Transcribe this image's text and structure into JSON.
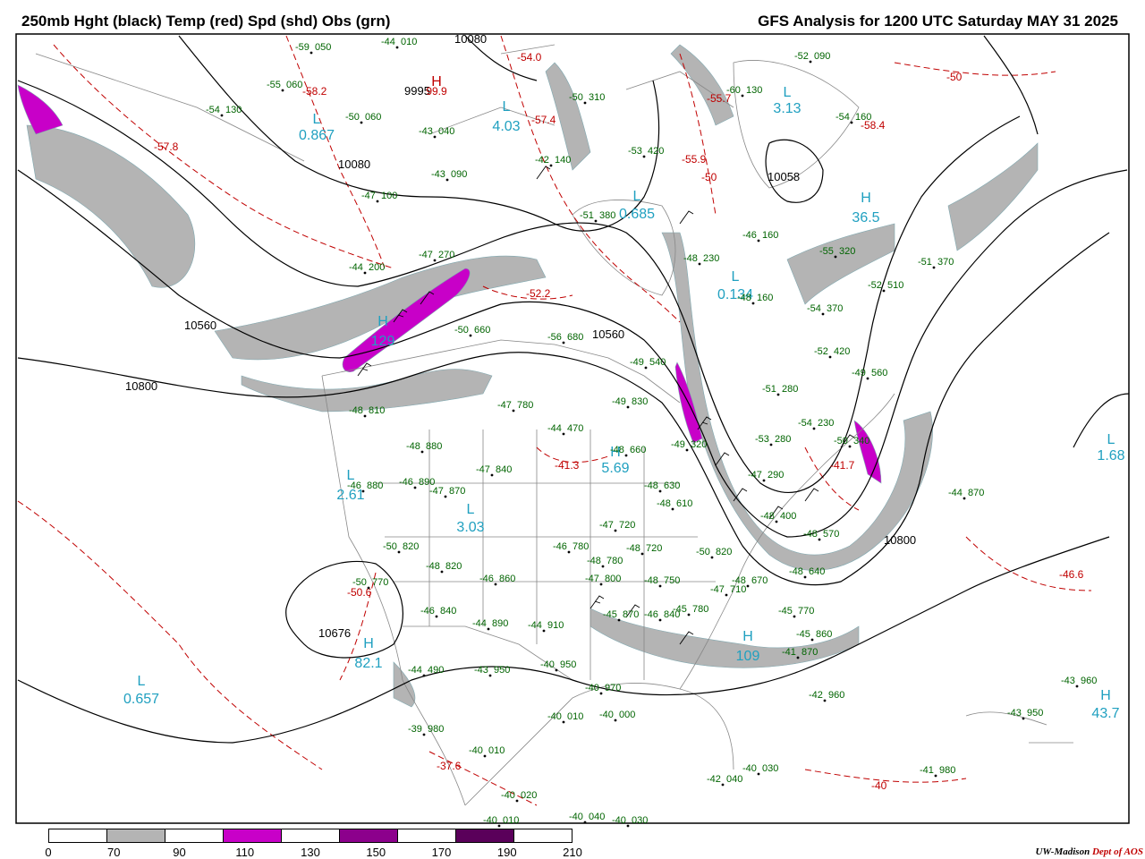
{
  "header": {
    "left_title": "250mb Hght (black) Temp (red) Spd (shd) Obs (grn)",
    "right_title": "GFS Analysis for 1200 UTC Saturday  MAY 31 2025"
  },
  "colors": {
    "height": "#000000",
    "temp": "#c00000",
    "obs": "#006400",
    "label_cyan": "#20a0c0",
    "shade_70": "#b4b4b4",
    "shade_110": "#c800c8",
    "shade_150": "#8c008c",
    "shade_190": "#5a005a",
    "borders": "#888888"
  },
  "height_labels": [
    "10800",
    "10560",
    "10080",
    "10800",
    "10560",
    "10800",
    "10058",
    "10676",
    "10080",
    "9995"
  ],
  "temp_labels": [
    "-54.0",
    "-58.2",
    "-57.8",
    "-57.4",
    "-55.9",
    "-55.7",
    "-50",
    "-58.4",
    "-52.2",
    "-41.3",
    "-41.7",
    "-46.6",
    "-37.6",
    "-40",
    "-50",
    "-50.6"
  ],
  "centers": [
    {
      "letter": "H",
      "value": "99.9",
      "color": "#c00000"
    },
    {
      "letter": "L",
      "value": "4.03",
      "color": "#20a0c0"
    },
    {
      "letter": "L",
      "value": "0.867",
      "color": "#20a0c0"
    },
    {
      "letter": "L",
      "value": "3.13",
      "color": "#20a0c0"
    },
    {
      "letter": "H",
      "value": "36.5",
      "color": "#20a0c0"
    },
    {
      "letter": "H",
      "value": "129",
      "color": "#20a0c0"
    },
    {
      "letter": "L",
      "value": "2.61",
      "color": "#20a0c0"
    },
    {
      "letter": "L",
      "value": "3.03",
      "color": "#20a0c0"
    },
    {
      "letter": "L",
      "value": "0.685",
      "color": "#20a0c0"
    },
    {
      "letter": "L",
      "value": "0.134",
      "color": "#20a0c0"
    },
    {
      "letter": "H",
      "value": "5.69",
      "color": "#20a0c0"
    },
    {
      "letter": "L",
      "value": "1.68",
      "color": "#20a0c0"
    },
    {
      "letter": "H",
      "value": "82.1",
      "color": "#20a0c0"
    },
    {
      "letter": "L",
      "value": "0.657",
      "color": "#20a0c0"
    },
    {
      "letter": "H",
      "value": "109",
      "color": "#20a0c0"
    },
    {
      "letter": "H",
      "value": "43.7",
      "color": "#20a0c0"
    }
  ],
  "observations": [
    {
      "t": "-59",
      "h": "050"
    },
    {
      "t": "-44",
      "h": "010"
    },
    {
      "t": "-52",
      "h": "090"
    },
    {
      "t": "-55",
      "h": "060"
    },
    {
      "t": "-54",
      "h": "130"
    },
    {
      "t": "-50",
      "h": "060"
    },
    {
      "t": "-50",
      "h": "310"
    },
    {
      "t": "-60",
      "h": "130"
    },
    {
      "t": "-54",
      "h": "160"
    },
    {
      "t": "-43",
      "h": "040"
    },
    {
      "t": "-53",
      "h": "420"
    },
    {
      "t": "-42",
      "h": "140"
    },
    {
      "t": "-43",
      "h": "090"
    },
    {
      "t": "-47",
      "h": "100"
    },
    {
      "t": "-51",
      "h": "380"
    },
    {
      "t": "-46",
      "h": "160"
    },
    {
      "t": "-55",
      "h": "320"
    },
    {
      "t": "-47",
      "h": "270"
    },
    {
      "t": "-48",
      "h": "230"
    },
    {
      "t": "-51",
      "h": "370"
    },
    {
      "t": "-52",
      "h": "510"
    },
    {
      "t": "-44",
      "h": "200"
    },
    {
      "t": "-48",
      "h": "160"
    },
    {
      "t": "-54",
      "h": "370"
    },
    {
      "t": "-50",
      "h": "660"
    },
    {
      "t": "-56",
      "h": "680"
    },
    {
      "t": "-52",
      "h": "420"
    },
    {
      "t": "-49",
      "h": "540"
    },
    {
      "t": "-49",
      "h": "560"
    },
    {
      "t": "-48",
      "h": "810"
    },
    {
      "t": "-47",
      "h": "780"
    },
    {
      "t": "-49",
      "h": "830"
    },
    {
      "t": "-51",
      "h": "280"
    },
    {
      "t": "-44",
      "h": "470"
    },
    {
      "t": "-54",
      "h": "230"
    },
    {
      "t": "-48",
      "h": "880"
    },
    {
      "t": "-48",
      "h": "660"
    },
    {
      "t": "-49",
      "h": "320"
    },
    {
      "t": "-53",
      "h": "280"
    },
    {
      "t": "-47",
      "h": "840"
    },
    {
      "t": "-50",
      "h": "340"
    },
    {
      "t": "-46",
      "h": "890"
    },
    {
      "t": "-46",
      "h": "880"
    },
    {
      "t": "-47",
      "h": "870"
    },
    {
      "t": "-48",
      "h": "630"
    },
    {
      "t": "-47",
      "h": "290"
    },
    {
      "t": "-48",
      "h": "610"
    },
    {
      "t": "-44",
      "h": "870"
    },
    {
      "t": "-47",
      "h": "720"
    },
    {
      "t": "-48",
      "h": "400"
    },
    {
      "t": "-48",
      "h": "570"
    },
    {
      "t": "-50",
      "h": "820"
    },
    {
      "t": "-48",
      "h": "780"
    },
    {
      "t": "-48",
      "h": "720"
    },
    {
      "t": "-50",
      "h": "820"
    },
    {
      "t": "-48",
      "h": "820"
    },
    {
      "t": "-46",
      "h": "780"
    },
    {
      "t": "-46",
      "h": "860"
    },
    {
      "t": "-47",
      "h": "800"
    },
    {
      "t": "-48",
      "h": "750"
    },
    {
      "t": "-48",
      "h": "670"
    },
    {
      "t": "-48",
      "h": "640"
    },
    {
      "t": "-50",
      "h": "770"
    },
    {
      "t": "-47",
      "h": "710"
    },
    {
      "t": "-46",
      "h": "840"
    },
    {
      "t": "-45",
      "h": "870"
    },
    {
      "t": "-46",
      "h": "840"
    },
    {
      "t": "-45",
      "h": "780"
    },
    {
      "t": "-45",
      "h": "770"
    },
    {
      "t": "-44",
      "h": "890"
    },
    {
      "t": "-44",
      "h": "910"
    },
    {
      "t": "-45",
      "h": "860"
    },
    {
      "t": "-44",
      "h": "490"
    },
    {
      "t": "-43",
      "h": "950"
    },
    {
      "t": "-40",
      "h": "950"
    },
    {
      "t": "-41",
      "h": "870"
    },
    {
      "t": "-40",
      "h": "970"
    },
    {
      "t": "-42",
      "h": "960"
    },
    {
      "t": "-43",
      "h": "960"
    },
    {
      "t": "-40",
      "h": "010"
    },
    {
      "t": "-40",
      "h": "000"
    },
    {
      "t": "-43",
      "h": "950"
    },
    {
      "t": "-39",
      "h": "980"
    },
    {
      "t": "-40",
      "h": "010"
    },
    {
      "t": "-40",
      "h": "030"
    },
    {
      "t": "-42",
      "h": "040"
    },
    {
      "t": "-41",
      "h": "980"
    },
    {
      "t": "-40",
      "h": "020"
    },
    {
      "t": "-40",
      "h": "040"
    },
    {
      "t": "-40",
      "h": "030"
    },
    {
      "t": "-40",
      "h": "010"
    }
  ],
  "legend": {
    "ticks": [
      "0",
      "70",
      "90",
      "110",
      "130",
      "150",
      "170",
      "190",
      "210"
    ],
    "segment_colors": [
      "#ffffff",
      "#b4b4b4",
      "#ffffff",
      "#c800c8",
      "#ffffff",
      "#8c008c",
      "#ffffff",
      "#5a005a",
      "#ffffff"
    ]
  },
  "credit": {
    "org": "UW-Madison",
    "dept": "Dept of AOS"
  }
}
